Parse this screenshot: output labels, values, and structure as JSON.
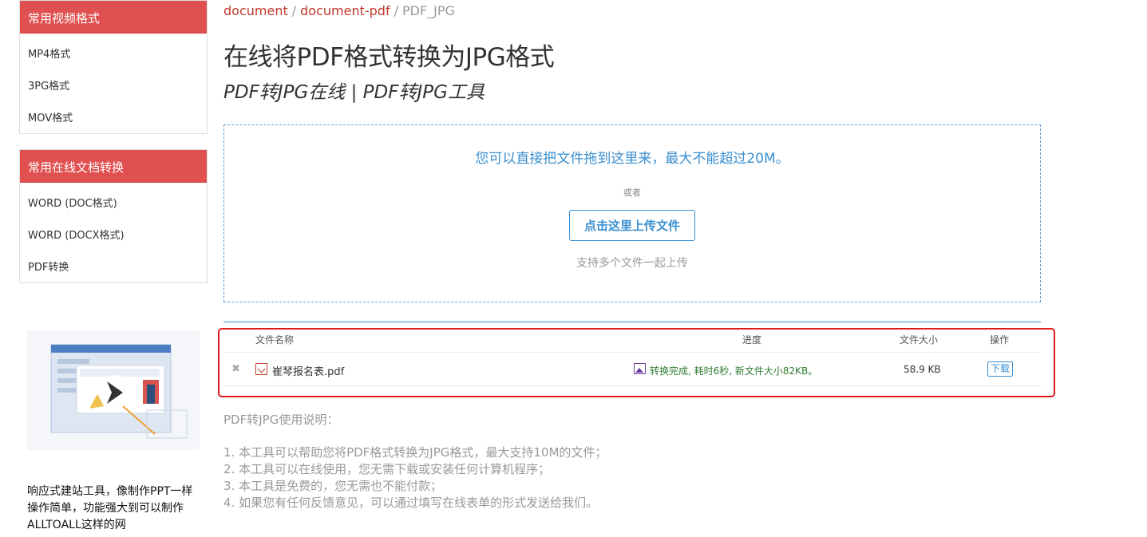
{
  "sidebar": {
    "video": {
      "title": "常用视频格式",
      "items": [
        "MP4格式",
        "3PG格式",
        "MOV格式"
      ]
    },
    "docs": {
      "title": "常用在线文档转换",
      "items": [
        "WORD (DOC格式)",
        "WORD (DOCX格式)",
        "PDF转换"
      ]
    },
    "promo": {
      "text": "响应式建站工具，像制作PPT一样操作简单，功能强大到可以制作ALLTOALL这样的网"
    }
  },
  "breadcrumb": {
    "items": [
      "document",
      "document-pdf"
    ],
    "current": "PDF_JPG",
    "sep": "/"
  },
  "page": {
    "title": "在线将PDF格式转换为JPG格式",
    "subtitle": "PDF转JPG在线 | PDF转JPG工具"
  },
  "dropzone": {
    "main": "您可以直接把文件拖到这里来，最大不能超过20M。",
    "or": "或者",
    "button": "点击这里上传文件",
    "hint": "支持多个文件一起上传"
  },
  "table": {
    "headers": {
      "name": "文件名称",
      "progress": "进度",
      "size": "文件大小",
      "action": "操作"
    },
    "rows": [
      {
        "remove": "✖",
        "name": "崔琴报名表.pdf",
        "status": "转换完成, 耗时6秒, 新文件大小82KB。",
        "size": "58.9 KB",
        "action": "下载"
      }
    ]
  },
  "usage": {
    "title": "PDF转JPG使用说明：",
    "items": [
      "1. 本工具可以帮助您将PDF格式转换为JPG格式，最大支持10M的文件；",
      "2. 本工具可以在线使用，您无需下载或安装任何计算机程序；",
      "3. 本工具是免费的，您无需也不能付款；",
      "4. 如果您有任何反馈意见，可以通过填写在线表单的形式发送给我们。"
    ]
  },
  "colors": {
    "accent_red": "#e05050",
    "link_blue": "#3a8fd0",
    "success_green": "#2e7d32",
    "highlight_red": "#e0191b"
  }
}
